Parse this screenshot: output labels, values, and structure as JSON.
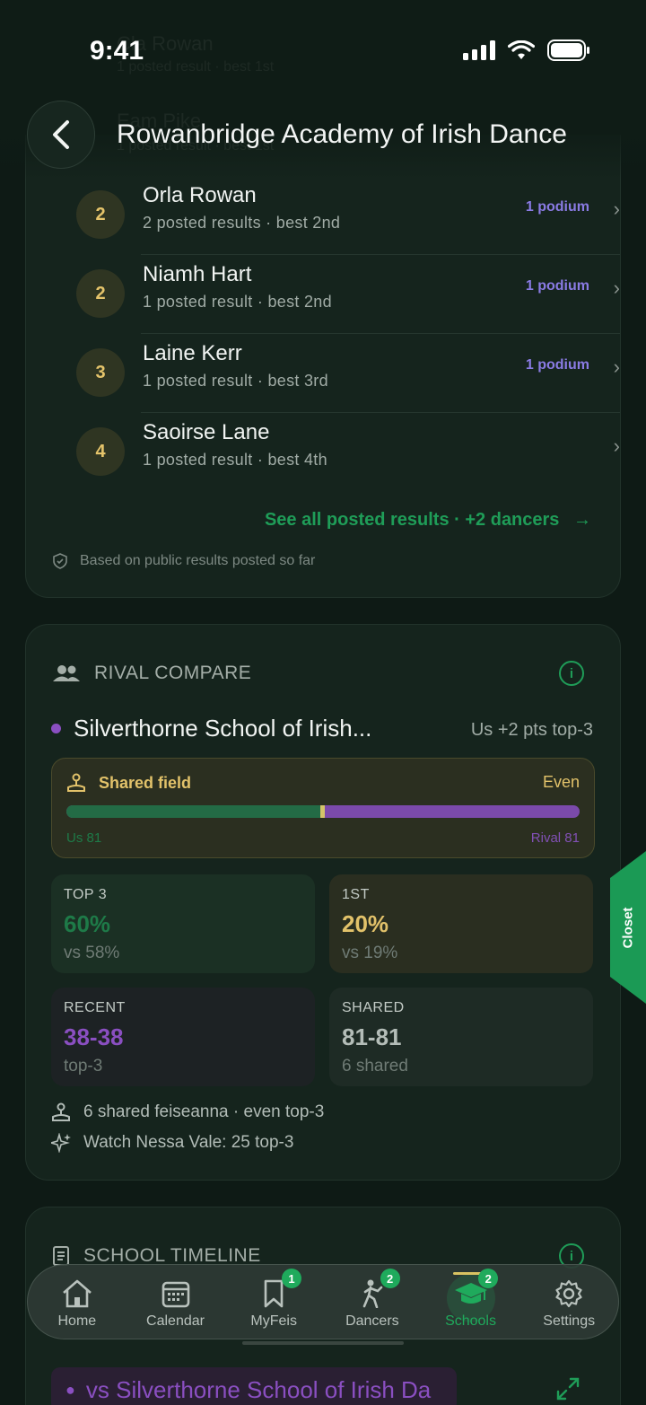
{
  "status": {
    "time": "9:41"
  },
  "header": {
    "title": "Rowanbridge Academy of Irish Dance",
    "ghost_rows": [
      {
        "name": "Cla Rowan",
        "sub": "1 posted result · best 1st"
      },
      {
        "name": "Eam Pike",
        "sub": "1 posted result · best 1st"
      }
    ]
  },
  "dancers": [
    {
      "rank": "2",
      "name": "Orla Rowan",
      "sub": "2 posted results · best 2nd",
      "podium": "1 podium"
    },
    {
      "rank": "2",
      "name": "Niamh Hart",
      "sub": "1 posted result · best 2nd",
      "podium": "1 podium"
    },
    {
      "rank": "3",
      "name": "Laine Kerr",
      "sub": "1 posted result · best 3rd",
      "podium": "1 podium"
    },
    {
      "rank": "4",
      "name": "Saoirse Lane",
      "sub": "1 posted result · best 4th",
      "podium": ""
    }
  ],
  "see_all": "See all posted results · +2 dancers",
  "footnote": "Based on public results posted so far",
  "rival": {
    "section_title": "RIVAL COMPARE",
    "name": "Silverthorne School of Irish...",
    "meta": "Us +2 pts top-3",
    "shared_field": {
      "title": "Shared field",
      "status": "Even",
      "us_label": "Us 81",
      "rival_label": "Rival 81",
      "us_share": 0.5
    },
    "stats": {
      "top3": {
        "label": "TOP 3",
        "value": "60%",
        "sub": "vs 58%",
        "color": "#1e7a48"
      },
      "first": {
        "label": "1ST",
        "value": "20%",
        "sub": "vs 19%",
        "color": "#e2c26a"
      },
      "recent": {
        "label": "RECENT",
        "value": "38-38",
        "sub": "top-3",
        "color": "#8a4fc1"
      },
      "shared": {
        "label": "SHARED",
        "value": "81-81",
        "sub": "6 shared",
        "color": "#b4bdb8"
      }
    },
    "facts": [
      "6 shared feiseanna · even top-3",
      "Watch Nessa Vale: 25 top-3"
    ]
  },
  "timeline": {
    "section_title": "SCHOOL TIMELINE",
    "vs_label": "vs Silverthorne School of Irish Da"
  },
  "closet_tab": "Closet",
  "tabbar": [
    {
      "label": "Home",
      "badge": ""
    },
    {
      "label": "Calendar",
      "badge": ""
    },
    {
      "label": "MyFeis",
      "badge": "1"
    },
    {
      "label": "Dancers",
      "badge": "2"
    },
    {
      "label": "Schools",
      "badge": "2"
    },
    {
      "label": "Settings",
      "badge": ""
    }
  ],
  "colors": {
    "accent": "#1faa5c",
    "gold": "#e2c26a",
    "rival": "#8a4fc1",
    "podium": "#8a7be4"
  }
}
